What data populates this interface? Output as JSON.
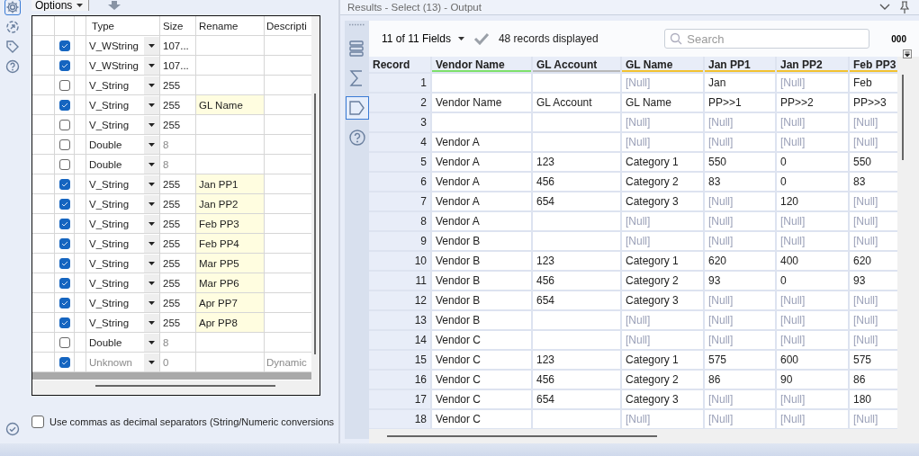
{
  "config_panel": {
    "options_tab": "Options",
    "side_tools": [
      {
        "kind": "gear",
        "selected": true
      },
      {
        "kind": "arrow-circle",
        "selected": false
      },
      {
        "kind": "tag",
        "selected": false
      },
      {
        "kind": "help",
        "selected": false
      }
    ],
    "field_grid": {
      "columns": [
        "Type",
        "Size",
        "Rename",
        "Descripti"
      ],
      "rows": [
        {
          "checked": true,
          "type": "V_WString",
          "size": "107..."
        },
        {
          "checked": true,
          "type": "V_WString",
          "size": "107..."
        },
        {
          "checked": false,
          "type": "V_String",
          "size": "255"
        },
        {
          "checked": true,
          "type": "V_String",
          "size": "255",
          "rename": "GL Name"
        },
        {
          "checked": false,
          "type": "V_String",
          "size": "255"
        },
        {
          "checked": false,
          "type": "Double",
          "size": "8",
          "size_muted": true
        },
        {
          "checked": false,
          "type": "Double",
          "size": "8",
          "size_muted": true
        },
        {
          "checked": true,
          "type": "V_String",
          "size": "255",
          "rename": "Jan PP1"
        },
        {
          "checked": true,
          "type": "V_String",
          "size": "255",
          "rename": "Jan PP2"
        },
        {
          "checked": true,
          "type": "V_String",
          "size": "255",
          "rename": "Feb PP3"
        },
        {
          "checked": true,
          "type": "V_String",
          "size": "255",
          "rename": "Feb PP4"
        },
        {
          "checked": true,
          "type": "V_String",
          "size": "255",
          "rename": "Mar PP5"
        },
        {
          "checked": true,
          "type": "V_String",
          "size": "255",
          "rename": "Mar PP6"
        },
        {
          "checked": true,
          "type": "V_String",
          "size": "255",
          "rename": "Apr PP7"
        },
        {
          "checked": true,
          "type": "V_String",
          "size": "255",
          "rename": "Apr PP8"
        },
        {
          "checked": false,
          "type": "Double",
          "size": "8",
          "size_muted": true
        },
        {
          "checked": true,
          "type": "Unknown",
          "type_muted": true,
          "size": "0",
          "size_muted": true,
          "description": "Dynamic"
        }
      ]
    },
    "decimal_option": {
      "label": "Use commas as decimal separators (String/Numeric conversions",
      "checked": false
    }
  },
  "results": {
    "title": "Results - Select (13) - Output",
    "side_tabs": [
      {
        "kind": "list",
        "selected": false
      },
      {
        "kind": "sigma",
        "selected": false
      },
      {
        "kind": "tag",
        "selected": true
      },
      {
        "kind": "help",
        "selected": false
      }
    ],
    "fields_menu": "11 of 11 Fields",
    "records_displayed": "48 records displayed",
    "search": {
      "placeholder": "Search"
    },
    "number_format": "000",
    "table": {
      "columns": [
        {
          "label": "Record"
        },
        {
          "label": "Vendor Name",
          "color": "#7ee06b"
        },
        {
          "label": "GL Account",
          "color": "#b8b8b8"
        },
        {
          "label": "GL Name",
          "color": "#f2c230"
        },
        {
          "label": "Jan PP1",
          "color": "#f2c230"
        },
        {
          "label": "Jan PP2",
          "color": "#f2c230"
        },
        {
          "label": "Feb PP3",
          "color": "#f2c230"
        }
      ],
      "rows": [
        {
          "cells": [
            "1",
            "",
            "",
            {
              "text": "[Null]",
              "null": true
            },
            "Jan",
            {
              "text": "[Null]",
              "null": true
            },
            "Feb"
          ]
        },
        {
          "cells": [
            "2",
            "Vendor Name",
            "GL Account",
            "GL Name",
            "PP>>1",
            "PP>>2",
            "PP>>3"
          ]
        },
        {
          "cells": [
            "3",
            "",
            "",
            {
              "text": "[Null]",
              "null": true
            },
            {
              "text": "[Null]",
              "null": true
            },
            {
              "text": "[Null]",
              "null": true
            },
            {
              "text": "[Null]",
              "null": true
            }
          ]
        },
        {
          "cells": [
            "4",
            "Vendor A",
            "",
            {
              "text": "[Null]",
              "null": true
            },
            {
              "text": "[Null]",
              "null": true
            },
            {
              "text": "[Null]",
              "null": true
            },
            {
              "text": "[Null]",
              "null": true
            }
          ]
        },
        {
          "cells": [
            "5",
            "Vendor A",
            "123",
            "Category 1",
            "550",
            "0",
            "550"
          ]
        },
        {
          "cells": [
            "6",
            "Vendor A",
            "456",
            "Category 2",
            "83",
            "0",
            "83"
          ]
        },
        {
          "cells": [
            "7",
            "Vendor A",
            "654",
            "Category 3",
            {
              "text": "[Null]",
              "null": true
            },
            "120",
            {
              "text": "[Null]",
              "null": true
            }
          ]
        },
        {
          "cells": [
            "8",
            "Vendor A",
            "",
            {
              "text": "[Null]",
              "null": true
            },
            {
              "text": "[Null]",
              "null": true
            },
            {
              "text": "[Null]",
              "null": true
            },
            {
              "text": "[Null]",
              "null": true
            }
          ]
        },
        {
          "cells": [
            "9",
            "Vendor B",
            "",
            {
              "text": "[Null]",
              "null": true
            },
            {
              "text": "[Null]",
              "null": true
            },
            {
              "text": "[Null]",
              "null": true
            },
            {
              "text": "[Null]",
              "null": true
            }
          ]
        },
        {
          "cells": [
            "10",
            "Vendor B",
            "123",
            "Category 1",
            "620",
            "400",
            "620"
          ]
        },
        {
          "cells": [
            "11",
            "Vendor B",
            "456",
            "Category 2",
            "93",
            "0",
            "93"
          ]
        },
        {
          "cells": [
            "12",
            "Vendor B",
            "654",
            "Category 3",
            {
              "text": "[Null]",
              "null": true
            },
            {
              "text": "[Null]",
              "null": true
            },
            {
              "text": "[Null]",
              "null": true
            }
          ]
        },
        {
          "cells": [
            "13",
            "Vendor B",
            "",
            {
              "text": "[Null]",
              "null": true
            },
            {
              "text": "[Null]",
              "null": true
            },
            {
              "text": "[Null]",
              "null": true
            },
            {
              "text": "[Null]",
              "null": true
            }
          ]
        },
        {
          "cells": [
            "14",
            "Vendor C",
            "",
            {
              "text": "[Null]",
              "null": true
            },
            {
              "text": "[Null]",
              "null": true
            },
            {
              "text": "[Null]",
              "null": true
            },
            {
              "text": "[Null]",
              "null": true
            }
          ]
        },
        {
          "cells": [
            "15",
            "Vendor C",
            "123",
            "Category 1",
            "575",
            "600",
            "575"
          ]
        },
        {
          "cells": [
            "16",
            "Vendor C",
            "456",
            "Category 2",
            "86",
            "90",
            "86"
          ]
        },
        {
          "cells": [
            "17",
            "Vendor C",
            "654",
            "Category 3",
            {
              "text": "[Null]",
              "null": true
            },
            {
              "text": "[Null]",
              "null": true
            },
            "180"
          ]
        },
        {
          "cells": [
            "18",
            "Vendor C",
            "",
            {
              "text": "[Null]",
              "null": true
            },
            {
              "text": "[Null]",
              "null": true
            },
            {
              "text": "[Null]",
              "null": true
            },
            {
              "text": "[Null]",
              "null": true
            }
          ]
        }
      ]
    }
  }
}
